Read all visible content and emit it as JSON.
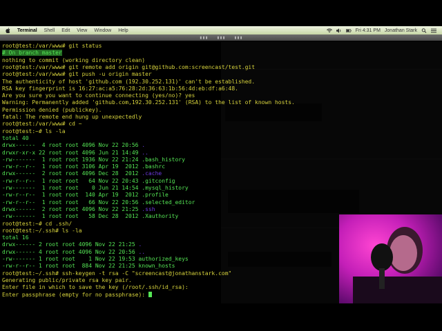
{
  "menubar": {
    "app_name": "Terminal",
    "items": [
      "Shell",
      "Edit",
      "View",
      "Window",
      "Help"
    ],
    "status": {
      "clock": "Fri 4:31 PM",
      "user": "Jonathan Stark"
    }
  },
  "terminal": {
    "lines": [
      [
        {
          "t": "root@test:/var/www# git status",
          "c": "yellow"
        }
      ],
      [
        {
          "t": "# On branch master",
          "c": "green",
          "hl": true
        }
      ],
      [
        {
          "t": "nothing to commit (working directory clean)",
          "c": "yellow"
        }
      ],
      [
        {
          "t": "root@test:/var/www# git remote add origin git@github.com:screencast/test.git",
          "c": "yellow"
        }
      ],
      [
        {
          "t": "root@test:/var/www# git push -u origin master",
          "c": "yellow"
        }
      ],
      [
        {
          "t": "The authenticity of host 'github.com (192.30.252.131)' can't be established.",
          "c": "yellow"
        }
      ],
      [
        {
          "t": "RSA key fingerprint is 16:27:ac:a5:76:28:2d:36:63:1b:56:4d:eb:df:a6:48.",
          "c": "yellow"
        }
      ],
      [
        {
          "t": "Are you sure you want to continue connecting (yes/no)? yes",
          "c": "yellow"
        }
      ],
      [
        {
          "t": "Warning: Permanently added 'github.com,192.30.252.131' (RSA) to the list of known hosts.",
          "c": "yellow"
        }
      ],
      [
        {
          "t": "Permission denied (publickey).",
          "c": "yellow"
        }
      ],
      [
        {
          "t": "fatal: The remote end hung up unexpectedly",
          "c": "yellow"
        }
      ],
      [
        {
          "t": "root@test:/var/www# cd ~",
          "c": "yellow"
        }
      ],
      [
        {
          "t": "root@test:~# ls -la",
          "c": "yellow"
        }
      ],
      [
        {
          "t": "total 40",
          "c": "green"
        }
      ],
      [
        {
          "t": "drwx------  4 root root 4096 Nov 22 20:56 ",
          "c": "green"
        },
        {
          "t": ".",
          "c": "purple"
        }
      ],
      [
        {
          "t": "drwxr-xr-x 22 root root 4096 Jun 21 14:49 ",
          "c": "green"
        },
        {
          "t": "..",
          "c": "purple"
        }
      ],
      [
        {
          "t": "-rw-------  1 root root 1936 Nov 22 21:24 .bash_history",
          "c": "green"
        }
      ],
      [
        {
          "t": "-rw-r--r--  1 root root 3106 Apr 19  2012 .bashrc",
          "c": "green"
        }
      ],
      [
        {
          "t": "drwx------  2 root root 4096 Dec 28  2012 ",
          "c": "green"
        },
        {
          "t": ".cache",
          "c": "purple"
        }
      ],
      [
        {
          "t": "-rw-r--r--  1 root root   64 Nov 22 20:43 .gitconfig",
          "c": "green"
        }
      ],
      [
        {
          "t": "-rw-------  1 root root    0 Jun 21 14:54 .mysql_history",
          "c": "green"
        }
      ],
      [
        {
          "t": "-rw-r--r--  1 root root  140 Apr 19  2012 .profile",
          "c": "green"
        }
      ],
      [
        {
          "t": "-rw-r--r--  1 root root   66 Nov 22 20:56 .selected_editor",
          "c": "green"
        }
      ],
      [
        {
          "t": "drwx------  2 root root 4096 Nov 22 21:25 ",
          "c": "green"
        },
        {
          "t": ".ssh",
          "c": "purple"
        }
      ],
      [
        {
          "t": "-rw-------  1 root root   58 Dec 28  2012 .Xauthority",
          "c": "green"
        }
      ],
      [
        {
          "t": "root@test:~# cd .ssh/",
          "c": "yellow"
        }
      ],
      [
        {
          "t": "root@test:~/.ssh# ls -la",
          "c": "yellow"
        }
      ],
      [
        {
          "t": "total 16",
          "c": "green"
        }
      ],
      [
        {
          "t": "drwx------ 2 root root 4096 Nov 22 21:25 ",
          "c": "green"
        },
        {
          "t": ".",
          "c": "purple"
        }
      ],
      [
        {
          "t": "drwx------ 4 root root 4096 Nov 22 20:56 ",
          "c": "green"
        },
        {
          "t": "..",
          "c": "purple"
        }
      ],
      [
        {
          "t": "-rw------- 1 root root    1 Nov 22 19:53 authorized_keys",
          "c": "green"
        }
      ],
      [
        {
          "t": "-rw-r--r-- 1 root root  884 Nov 22 21:25 known_hosts",
          "c": "green"
        }
      ],
      [
        {
          "t": "root@test:~/.ssh# ssh-keygen -t rsa -C \"screencast@jonathanstark.com\"",
          "c": "yellow"
        }
      ],
      [
        {
          "t": "Generating public/private rsa key pair.",
          "c": "yellow"
        }
      ],
      [
        {
          "t": "Enter file in which to save the key (/root/.ssh/id_rsa):",
          "c": "yellow"
        }
      ],
      [
        {
          "t": "Enter passphrase (empty for no passphrase): ",
          "c": "yellow"
        }
      ]
    ]
  },
  "colors": {
    "yellow": "#d7d33c",
    "green": "#55e655",
    "purple": "#6d3ae0",
    "highlight": "#246d24"
  }
}
